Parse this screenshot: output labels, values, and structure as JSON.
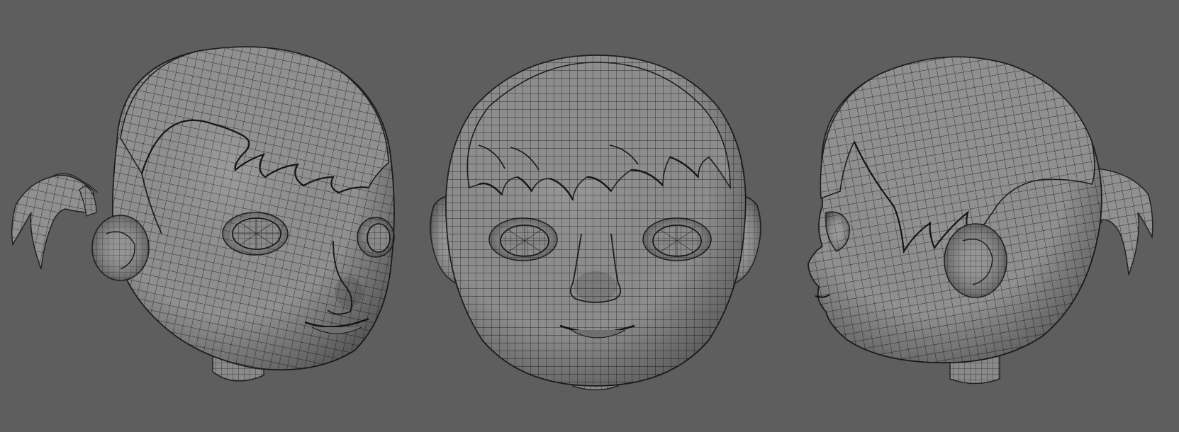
{
  "viewport": {
    "background": "#5e5e5e",
    "mesh_fill": "#8a8a8a",
    "wire_color": "#2a2a2a",
    "shade_color": "#3c3c3c"
  },
  "views": [
    {
      "view": "three-quarter-left",
      "icon": "head-mesh-icon"
    },
    {
      "view": "front",
      "icon": "head-mesh-icon"
    },
    {
      "view": "side-right",
      "icon": "head-mesh-icon"
    }
  ]
}
